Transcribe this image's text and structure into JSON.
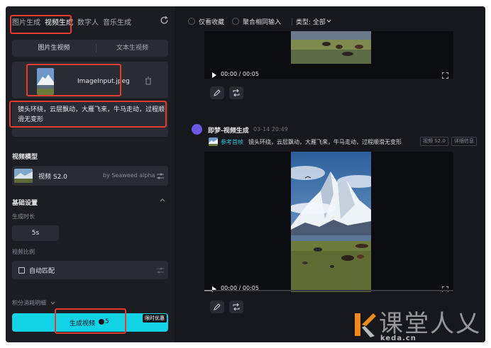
{
  "left": {
    "tabs": [
      {
        "label": "图片生成"
      },
      {
        "label": "视频生成"
      },
      {
        "label": "数字人"
      },
      {
        "label": "音乐生成"
      }
    ],
    "mode_tabs": [
      {
        "label": "图片生视频"
      },
      {
        "label": "文本生视频"
      }
    ],
    "upload": {
      "filename": "ImageInput.jpeg"
    },
    "prompt": "镜头环绕，云层飘动，大雁飞来，牛马走动，过程顺滑无变形",
    "model_section": {
      "title": "视频模型",
      "model_name": "视频 S2.0",
      "model_by": "by Seaweed alpha"
    },
    "basic_settings": {
      "title": "基础设置",
      "duration_label": "生成时长",
      "duration_value": "5s",
      "ratio_label": "视频比例",
      "ratio_value": "自动匹配"
    },
    "credit_detail": "积分消耗明细",
    "generate": {
      "label": "生成视频",
      "cost": "5",
      "badge": "限时优惠"
    }
  },
  "right": {
    "toolbar": {
      "favorites_only": "仅看收藏",
      "merge_same": "聚合相同输入",
      "type_label": "类型: 全部"
    },
    "video_top": {
      "current": "00:00",
      "separator": "/",
      "duration": "00:05"
    },
    "entry": {
      "title": "即梦-视频生成",
      "time": "03-14  20:49",
      "ref_label": "参考首帧",
      "prompt": "镜头环绕，云层飘动，大雁飞来，牛马走动，过程顺滑无变形",
      "tag_model": "视频 S2.0",
      "tag_detail": "详细信息"
    },
    "video_main": {
      "current": "00:00",
      "separator": "/",
      "duration": "00:05",
      "progress": 0.03
    }
  },
  "watermark": {
    "text": "课堂人乂",
    "url": "keda.cn"
  },
  "colors": {
    "accent": "#12d3e6",
    "highlight": "#e33b2f",
    "panel": "#1c1d23",
    "surface": "#2a2c34"
  }
}
